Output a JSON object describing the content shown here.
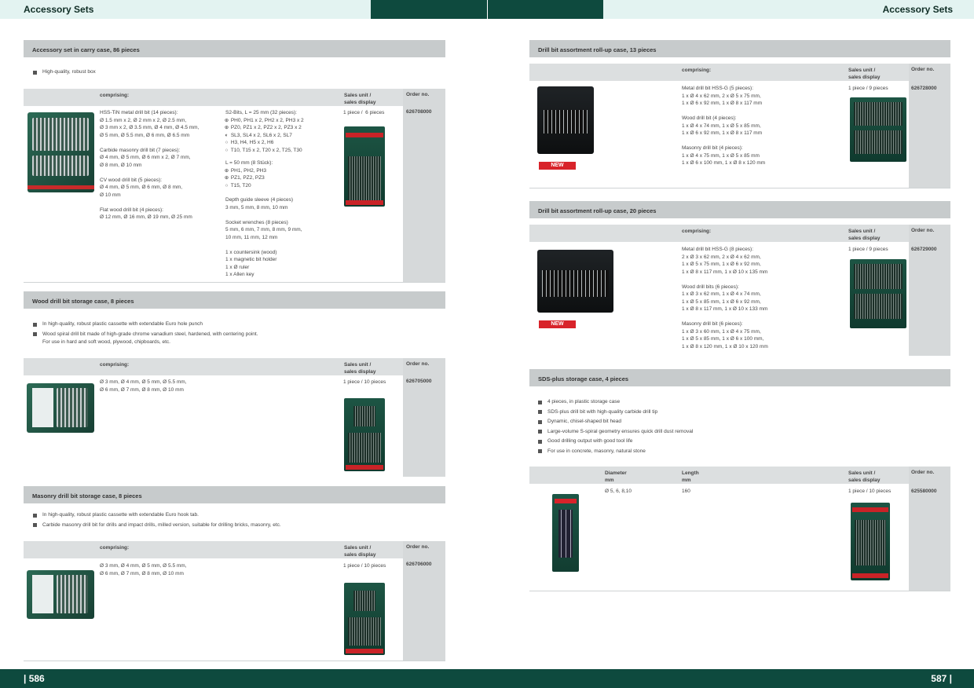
{
  "header": {
    "left_title": "Accessory Sets",
    "right_title": "Accessory Sets",
    "colors": {
      "bar_light": "#ddf0ee",
      "bar_dark": "#0e4a3e",
      "brand_red": "#d8232a"
    }
  },
  "footer": {
    "left_page": "| 586",
    "right_page": "587 |"
  },
  "common": {
    "comprising": "comprising:",
    "sales_unit": "Sales unit /\nsales display",
    "order_no": "Order no.",
    "new_badge": "NEW"
  },
  "sections": {
    "s1": {
      "title": "Accessory set in carry case, 86 pieces",
      "bullets": [
        "High-quality, robust box"
      ],
      "col1": "HSS-TiN metal drill bit (14 pieces):\nØ 1.5 mm x 2, Ø 2 mm x 2, Ø 2.5 mm,\nØ 3 mm x 2, Ø 3.5 mm, Ø 4 mm, Ø 4.5 mm,\nØ 5 mm, Ø 5.5 mm, Ø 6 mm, Ø 6.5 mm\n\nCarbide masonry drill bit (7 pieces):\nØ 4 mm, Ø 5 mm, Ø 6 mm x 2, Ø 7 mm,\nØ 8 mm, Ø 10 mm\n\nCV wood drill bit (5 pieces):\nØ 4 mm, Ø 5 mm, Ø 6 mm, Ø 8 mm,\nØ 10 mm\n\nFlat wood drill bit (4 pieces):\nØ 12 mm, Ø 16 mm, Ø 19 mm, Ø 25 mm",
      "col2_a": "S2-Bits, L = 25 mm (32 pieces):",
      "col2_a_items": [
        {
          "icon": "⊕",
          "text": "PH0, PH1 x 2, PH2 x 2, PH3 x 2"
        },
        {
          "icon": "⊕",
          "text": "PZ0, PZ1 x 2, PZ2 x 2, PZ3 x 2"
        },
        {
          "icon": "◐",
          "text": "SL3, SL4 x 2, SL6 x 2, SL7"
        },
        {
          "icon": "○",
          "text": "H3, H4, H5 x 2, H6"
        },
        {
          "icon": "○",
          "text": "T10, T15 x 2, T20 x 2, T25, T30"
        }
      ],
      "col2_b": "L = 50 mm (8 Stück):",
      "col2_b_items": [
        {
          "icon": "⊕",
          "text": "PH1, PH2, PH3"
        },
        {
          "icon": "⊕",
          "text": "PZ1, PZ2, PZ3"
        },
        {
          "icon": "○",
          "text": "T15, T20"
        }
      ],
      "col2_c": "Depth guide sleeve (4 pieces)\n3 mm, 5 mm, 8 mm, 10 mm\n\nSocket wrenches (8 pieces)\n5 mm, 6 mm, 7 mm, 8 mm, 9 mm,\n10 mm, 11 mm, 12 mm\n\n1 x countersink (wood)\n1 x magnetic bit holder\n1 x Ø ruler\n1 x Allen key",
      "sales": "1 piece /  6 pieces",
      "order": "626708000"
    },
    "s2": {
      "title": "Wood drill bit storage case, 8 pieces",
      "bullets": [
        "In high-quality, robust plastic cassette with extendable Euro hole punch",
        "Wood spiral drill bit made of high-grade chrome vanadium steel, hardened, with centering point.\nFor use in hard and soft wood, plywood, chipboards, etc."
      ],
      "col1": "Ø 3 mm, Ø 4 mm, Ø 5 mm, Ø 5.5 mm,\nØ 6 mm, Ø 7 mm, Ø 8 mm, Ø 10 mm",
      "sales": "1 piece / 10 pieces",
      "order": "626705000"
    },
    "s3": {
      "title": "Masonry drill bit storage case, 8 pieces",
      "bullets": [
        "In high-quality, robust plastic cassette with extendable Euro hook tab.",
        "Carbide masonry drill bit for drills and impact drills, milled version, suitable for drilling bricks, masonry, etc."
      ],
      "col1": "Ø 3 mm, Ø 4 mm, Ø 5 mm, Ø 5.5 mm,\nØ 6 mm, Ø 7 mm, Ø 8 mm, Ø 10 mm",
      "sales": "1 piece / 10 pieces",
      "order": "626706000"
    },
    "s4": {
      "title": "Drill bit assortment roll-up case, 13 pieces",
      "col1": "Metal drill bit HSS-G (5 pieces):\n1 x Ø 4 x 62 mm, 2 x Ø 5 x 75 mm,\n1 x Ø 6 x 92 mm, 1 x Ø 8 x 117 mm\n\nWood drill bit (4 pieces):\n1 x Ø 4 x 74 mm, 1 x Ø 5 x 85 mm,\n1 x Ø 6 x 92 mm, 1 x Ø 8 x 117 mm\n\nMasonry drill bit (4 pieces):\n1 x Ø 4 x 75 mm, 1 x Ø 5 x 85 mm\n1 x Ø 6 x 100 mm, 1 x Ø 8 x 120 mm",
      "sales": "1 piece / 9 pieces",
      "order": "626728000"
    },
    "s5": {
      "title": "Drill bit assortment roll-up case, 20 pieces",
      "col1": "Metal drill bit HSS-G (8 pieces):\n2 x Ø 3 x 62 mm, 2 x Ø 4 x 62 mm,\n1 x Ø 5 x 75 mm, 1 x Ø 6 x 92 mm,\n1 x Ø 8 x 117 mm, 1 x Ø 10 x 135 mm\n\nWood drill bits (6 pieces):\n1 x Ø 3 x 62 mm, 1 x Ø 4 x 74 mm,\n1 x Ø 5 x 85 mm, 1 x Ø 6 x 92 mm,\n1 x Ø 8 x 117 mm, 1 x Ø 10 x 133 mm\n\nMasonry drill bit (6 pieces):\n1 x Ø 3 x 60 mm, 1 x Ø 4 x 75 mm,\n1 x Ø 5 x 85 mm, 1 x Ø 6 x 100 mm,\n1 x Ø 8 x 120 mm, 1 x Ø 10 x 120 mm",
      "sales": "1 piece / 9 pieces",
      "order": "626729000"
    },
    "s6": {
      "title": "SDS-plus storage case, 4 pieces",
      "bullets": [
        "4 pieces, in plastic storage case",
        "SDS-plus drill bit with high-quality carbide drill tip",
        "Dynamic, chisel-shaped bit head",
        "Large-volume S-spiral geometry ensures quick drill dust removal",
        "Good drilling output with good tool life",
        "For use in concrete, masonry, natural stone"
      ],
      "th_diameter": "Diameter\nmm",
      "th_length": "Length\nmm",
      "diameter": "Ø 5, 6, 8,10",
      "length": "160",
      "sales": "1 piece / 10 pieces",
      "order": "625580000"
    }
  }
}
